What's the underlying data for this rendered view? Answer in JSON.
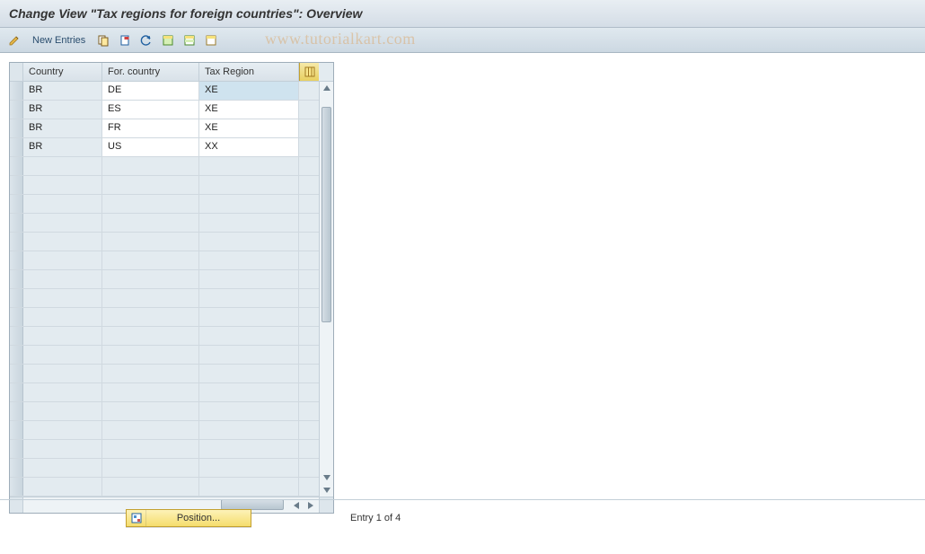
{
  "title": "Change View \"Tax regions for foreign countries\": Overview",
  "toolbar": {
    "new_entries_label": "New Entries"
  },
  "watermark": "www.tutorialkart.com",
  "table": {
    "columns": {
      "c1": "Country",
      "c2": "For. country",
      "c3": "Tax Region"
    },
    "rows": [
      {
        "country": "BR",
        "for_country": "DE",
        "tax_region": "XE",
        "selected": true
      },
      {
        "country": "BR",
        "for_country": "ES",
        "tax_region": "XE",
        "selected": false
      },
      {
        "country": "BR",
        "for_country": "FR",
        "tax_region": "XE",
        "selected": false
      },
      {
        "country": "BR",
        "for_country": "US",
        "tax_region": "XX",
        "selected": false
      }
    ],
    "empty_rows": 18
  },
  "footer": {
    "position_label": "Position...",
    "entry_text": "Entry 1 of 4"
  }
}
